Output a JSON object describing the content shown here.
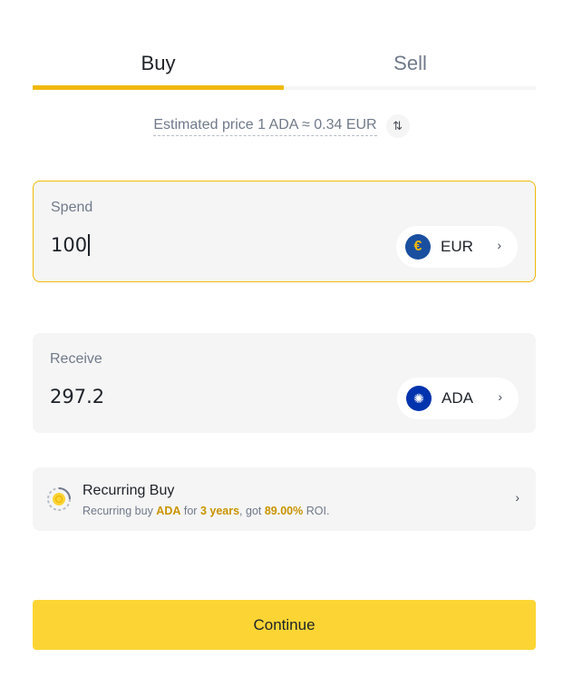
{
  "tabs": {
    "buy_label": "Buy",
    "sell_label": "Sell",
    "active": "Buy"
  },
  "estimate": {
    "text": "Estimated price 1 ADA ≈ 0.34 EUR",
    "swap_icon": "swap-vertical-arrows"
  },
  "spend": {
    "label": "Spend",
    "value": "100",
    "currency": "EUR",
    "currency_icon": "euro-coin"
  },
  "receive": {
    "label": "Receive",
    "value": "297.2",
    "currency": "ADA",
    "currency_icon": "cardano-coin"
  },
  "recurring": {
    "title": "Recurring Buy",
    "sub_prefix": "Recurring buy ",
    "sub_asset": "ADA",
    "sub_for": " for ",
    "sub_period": "3 years",
    "sub_got": ", got ",
    "sub_roi": "89.00%",
    "sub_suffix": " ROI."
  },
  "continue_label": "Continue",
  "colors": {
    "accent": "#f0b90b",
    "button": "#fcd535",
    "highlight": "#c99400",
    "muted": "#707a8a"
  }
}
